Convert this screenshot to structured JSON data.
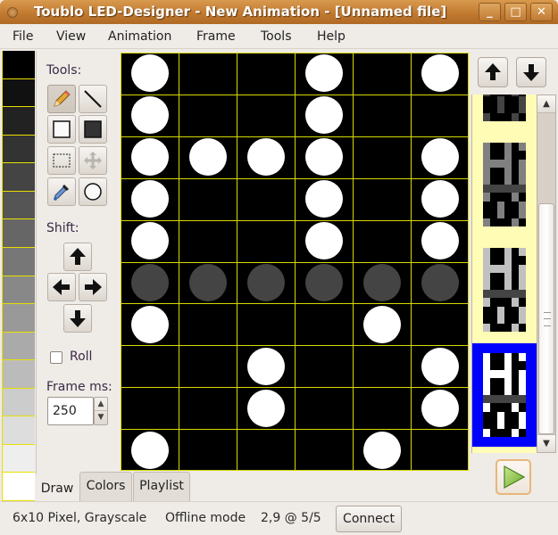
{
  "window": {
    "title": "Toublo LED-Designer - New Animation - [Unnamed file]",
    "controls": {
      "minimize": "_",
      "maximize": "□",
      "close": "✕"
    }
  },
  "menubar": {
    "items": [
      "File",
      "View",
      "Animation",
      "Frame",
      "Tools",
      "Help"
    ]
  },
  "palette": {
    "colors": [
      "#000000",
      "#111111",
      "#222222",
      "#333333",
      "#444444",
      "#555555",
      "#666666",
      "#777777",
      "#888888",
      "#999999",
      "#aaaaaa",
      "#bbbbbb",
      "#cccccc",
      "#dddddd",
      "#eeeeee",
      "#ffffff"
    ]
  },
  "tools": {
    "heading": "Tools:",
    "buttons": [
      {
        "name": "pencil-tool",
        "icon": "pencil-icon",
        "active": true
      },
      {
        "name": "line-tool",
        "icon": "line-icon",
        "active": false
      },
      {
        "name": "rectangle-tool",
        "icon": "rectangle-outline-icon",
        "active": false
      },
      {
        "name": "filled-rectangle-tool",
        "icon": "rectangle-filled-icon",
        "active": false
      },
      {
        "name": "selection-tool",
        "icon": "selection-icon",
        "active": false
      },
      {
        "name": "move-tool",
        "icon": "move-icon",
        "active": false,
        "disabled": true
      },
      {
        "name": "eyedropper-tool",
        "icon": "eyedropper-icon",
        "active": false
      },
      {
        "name": "circle-tool",
        "icon": "circle-icon",
        "active": false
      }
    ],
    "shift_heading": "Shift:",
    "shift": {
      "up": "shift-up",
      "left": "shift-left",
      "right": "shift-right",
      "down": "shift-down"
    },
    "roll_label": "Roll",
    "roll_checked": false,
    "frame_ms_label": "Frame ms:",
    "frame_ms_value": "250"
  },
  "tabs": [
    {
      "label": "Draw",
      "active": true
    },
    {
      "label": "Colors",
      "active": false
    },
    {
      "label": "Playlist",
      "active": false
    }
  ],
  "canvas": {
    "columns": 6,
    "rows": 10,
    "grid_color": "#d8d800",
    "pixels": [
      [
        "#ffffff",
        "#000000",
        "#000000",
        "#ffffff",
        "#000000",
        "#ffffff"
      ],
      [
        "#ffffff",
        "#000000",
        "#000000",
        "#ffffff",
        "#000000",
        "#000000"
      ],
      [
        "#ffffff",
        "#ffffff",
        "#ffffff",
        "#ffffff",
        "#000000",
        "#ffffff"
      ],
      [
        "#ffffff",
        "#000000",
        "#000000",
        "#ffffff",
        "#000000",
        "#ffffff"
      ],
      [
        "#ffffff",
        "#000000",
        "#000000",
        "#ffffff",
        "#000000",
        "#ffffff"
      ],
      [
        "#444444",
        "#444444",
        "#444444",
        "#444444",
        "#444444",
        "#444444"
      ],
      [
        "#ffffff",
        "#000000",
        "#000000",
        "#000000",
        "#ffffff",
        "#000000"
      ],
      [
        "#000000",
        "#000000",
        "#ffffff",
        "#000000",
        "#000000",
        "#ffffff"
      ],
      [
        "#000000",
        "#000000",
        "#ffffff",
        "#000000",
        "#000000",
        "#ffffff"
      ],
      [
        "#ffffff",
        "#000000",
        "#000000",
        "#000000",
        "#ffffff",
        "#000000"
      ]
    ]
  },
  "frames": {
    "current": 5,
    "total": 5,
    "highlight_color": "#0000ff",
    "background_color": "#fffcb5",
    "visible": [
      {
        "index": 2,
        "level": "#444444"
      },
      {
        "index": 3,
        "level": "#808080"
      },
      {
        "index": 4,
        "level": "#c0c0c0"
      },
      {
        "index": 5,
        "level": "#ffffff",
        "selected": true
      }
    ],
    "scroll_position": 0.7
  },
  "statusbar": {
    "format": "6x10 Pixel, Grayscale",
    "mode": "Offline mode",
    "position": "2,9 @ 5/5",
    "connect_label": "Connect"
  }
}
